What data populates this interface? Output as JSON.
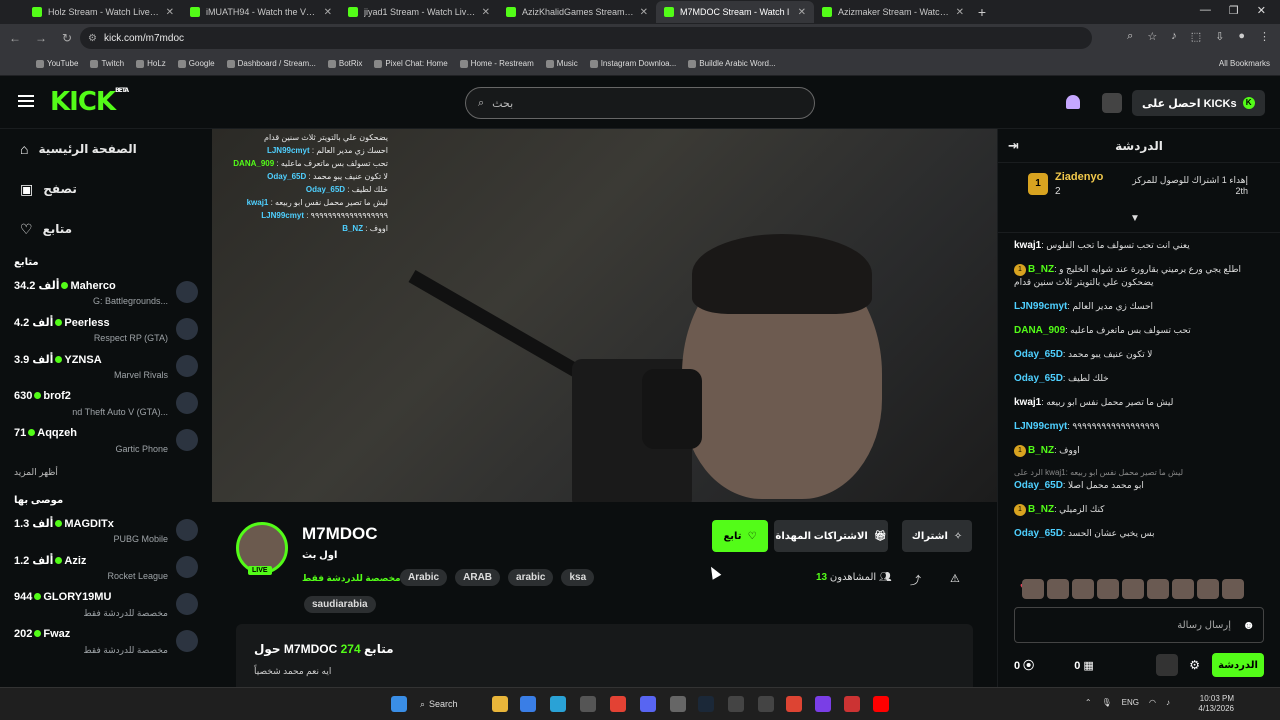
{
  "browser": {
    "tabs": [
      {
        "title": "Holz Stream - Watch Live on Ki"
      },
      {
        "title": "iMUATH94 - Watch the VOD o"
      },
      {
        "title": "jiyad1 Stream - Watch Live on"
      },
      {
        "title": "AzizKhalidGames Stream - Watc"
      },
      {
        "title": "M7MDOC Stream - Watch l"
      },
      {
        "title": "Azizmaker Stream - Watch Liv"
      }
    ],
    "url": "kick.com/m7mdoc",
    "bookmarks": [
      "YouTube",
      "Twitch",
      "HoLz",
      "Google",
      "Dashboard / Stream...",
      "BotRix",
      "Pixel Chat: Home",
      "Home - Restream",
      "Music",
      "Instagram Downloa...",
      "Buildle Arabic Word..."
    ],
    "all_bookmarks": "All Bookmarks"
  },
  "kick": {
    "logo": "KICK",
    "beta": "BETA",
    "search_placeholder": "بحث",
    "get_kicks": "احصل على KICKs"
  },
  "sidebar": {
    "nav": [
      {
        "label": "الصفحة الرئيسية",
        "icon": "home-icon"
      },
      {
        "label": "تصفح",
        "icon": "browse-icon"
      },
      {
        "label": "متابع",
        "icon": "heart-icon"
      }
    ],
    "following_title": "متابع",
    "following": [
      {
        "count": "34.2 ألف",
        "name": "Maherco",
        "game": "G: Battlegrounds..."
      },
      {
        "count": "4.2 ألف",
        "name": "Peerless",
        "game": "Respect RP (GTA)"
      },
      {
        "count": "3.9 ألف",
        "name": "YZNSA",
        "game": "Marvel Rivals"
      },
      {
        "count": "630",
        "name": "brof2",
        "game": "nd Theft Auto V (GTA)..."
      },
      {
        "count": "71",
        "name": "Aqqzeh",
        "game": "Gartic Phone"
      }
    ],
    "show_more": "أظهر المزيد",
    "recommended_title": "موصى بها",
    "recommended": [
      {
        "count": "1.3 ألف",
        "name": "MAGDITx",
        "game": "PUBG Mobile"
      },
      {
        "count": "1.2 ألف",
        "name": "Aziz",
        "game": "Rocket League"
      },
      {
        "count": "944",
        "name": "GLORY19MU",
        "game": "مخصصة للدردشة فقط"
      },
      {
        "count": "202",
        "name": "Fwaz",
        "game": "مخصصة للدردشة فقط"
      }
    ]
  },
  "overlay": [
    {
      "user": "",
      "text": "يضحكون علي بالتويتر ثلاث سنين قدام"
    },
    {
      "user": "LJN99cmyt",
      "text": "احسك زي مدير العالم"
    },
    {
      "user": "DANA_909",
      "text": "تحب تسولف بس ماتعرف ماعليه"
    },
    {
      "user": "Oday_65D",
      "text": "لا تكون عنيف يبو محمد"
    },
    {
      "user": "Oday_65D",
      "text": "خلك لطيف"
    },
    {
      "user": "kwaj1",
      "text": "ليش ما تصير محمل نفس ابو ربيعه"
    },
    {
      "user": "LJN99cmyt",
      "text": "٩٩٩٩٩٩٩٩٩٩٩٩٩٩٩٩٩٩"
    },
    {
      "user": "B_NZ",
      "text": "اووف"
    }
  ],
  "channel": {
    "name": "M7MDOC",
    "title": "اول بث",
    "category": "مخصصة للدردشة فقط",
    "tags": [
      "Arabic",
      "ARAB",
      "arabic",
      "ksa"
    ],
    "tag_extra": "saudiarabia",
    "live": "LIVE",
    "follow": "تابع",
    "gift_subs": "الاشتراكات المهداة",
    "subscribe": "اشتراك",
    "viewers_label": "المشاهدون",
    "viewers": "13",
    "about_title": "حول M7MDOC",
    "followers": "274",
    "followers_label": "متابع",
    "about_text": "ايه نعم محمد شخصياً"
  },
  "chat": {
    "title": "الدردشة",
    "pinned": {
      "badge": "1",
      "user": "Ziadenyo",
      "count": "2",
      "text": "إهداء 1 اشتراك للوصول للمركز 2th"
    },
    "messages": [
      {
        "user": "kwaj1",
        "color": "#ffffff",
        "text": "يعني انت تحب تسولف ما تحب الفلوس"
      },
      {
        "user": "B_NZ",
        "color": "#53fc18",
        "badge": "1",
        "text": "اطلع يجي ورع يرميني بقارورة عند شوايه الخليج و يضحكون علي بالتويتر ثلاث سنين قدام"
      },
      {
        "user": "LJN99cmyt",
        "color": "#4fd0ff",
        "text": "احسك زي مدير العالم"
      },
      {
        "user": "DANA_909",
        "color": "#53fc18",
        "text": "تحب تسولف بس ماتعرف ماعليه"
      },
      {
        "user": "Oday_65D",
        "color": "#4fd0ff",
        "text": "لا تكون عنيف يبو محمد"
      },
      {
        "user": "Oday_65D",
        "color": "#4fd0ff",
        "text": "خلك لطيف"
      },
      {
        "user": "kwaj1",
        "color": "#ffffff",
        "text": "ليش ما تصير محمل نفس ابو ربيعه"
      },
      {
        "user": "LJN99cmyt",
        "color": "#4fd0ff",
        "text": "٩٩٩٩٩٩٩٩٩٩٩٩٩٩٩٩٩٩"
      },
      {
        "user": "B_NZ",
        "color": "#53fc18",
        "badge": "1",
        "text": "اووف"
      },
      {
        "user": "Oday_65D",
        "color": "#4fd0ff",
        "reply": "الرد على kwaj1: ليش ما تصير محمل نفس ابو ربيعه",
        "text": "ابو محمد محمل اصلا"
      },
      {
        "user": "B_NZ",
        "color": "#53fc18",
        "badge": "1",
        "text": "كنك الزميلي"
      },
      {
        "user": "Oday_65D",
        "color": "#4fd0ff",
        "text": "بس يخبي عشان الحسد"
      }
    ],
    "input_placeholder": "إرسال رسالة",
    "send": "الدردشة",
    "stat1": "0",
    "stat2": "0"
  },
  "taskbar": {
    "search": "Search",
    "lang": "ENG",
    "time": "10:03 PM",
    "date": "4/13/2026"
  }
}
